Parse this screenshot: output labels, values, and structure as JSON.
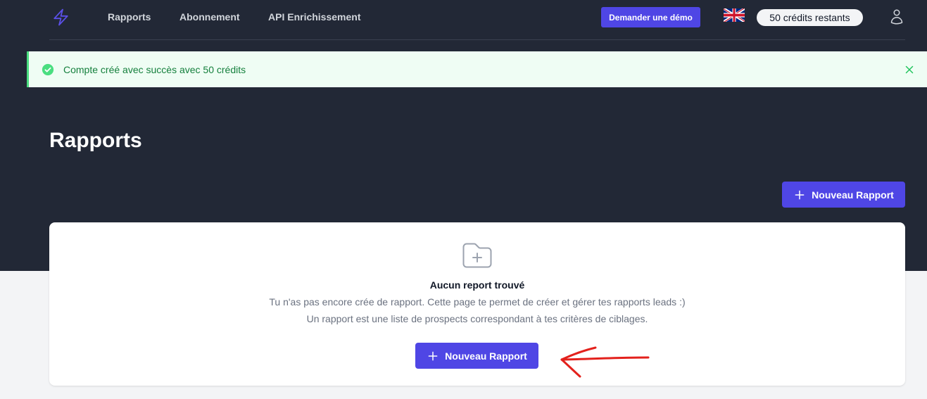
{
  "header": {
    "logo": {
      "icon": "lightning-bolt-icon",
      "color": "#5b50e8"
    },
    "nav": [
      {
        "label": "Rapports"
      },
      {
        "label": "Abonnement"
      },
      {
        "label": "API Enrichissement"
      }
    ],
    "demo_button": {
      "label": "Demander une démo"
    },
    "language": {
      "icon": "uk-flag-icon"
    },
    "credits_badge": {
      "label": "50 crédits restants"
    },
    "account": {
      "icon": "user-icon"
    }
  },
  "alert": {
    "icon": "check-circle-icon",
    "message": "Compte créé avec succès avec 50 crédits",
    "close_icon": "close-icon"
  },
  "page": {
    "title": "Rapports",
    "new_report_button": {
      "label": "Nouveau Rapport",
      "icon": "plus-icon"
    }
  },
  "empty_state": {
    "icon": "folder-plus-icon",
    "title": "Aucun report trouvé",
    "description": [
      "Tu n'as pas encore crée de rapport. Cette page te permet de créer et gérer tes rapports leads :)",
      "Un rapport est une liste de prospects correspondant à tes critères de ciblages."
    ],
    "cta_button": {
      "label": "Nouveau Rapport",
      "icon": "plus-icon"
    }
  },
  "annotation": {
    "icon": "red-arrow-icon",
    "color": "#e3211c"
  },
  "colors": {
    "header_background": "#222836",
    "page_background": "#f3f4f6",
    "accent": "#4f46e5",
    "success": "#4ade80",
    "success_background": "#effdf4",
    "success_text": "#15803d"
  }
}
